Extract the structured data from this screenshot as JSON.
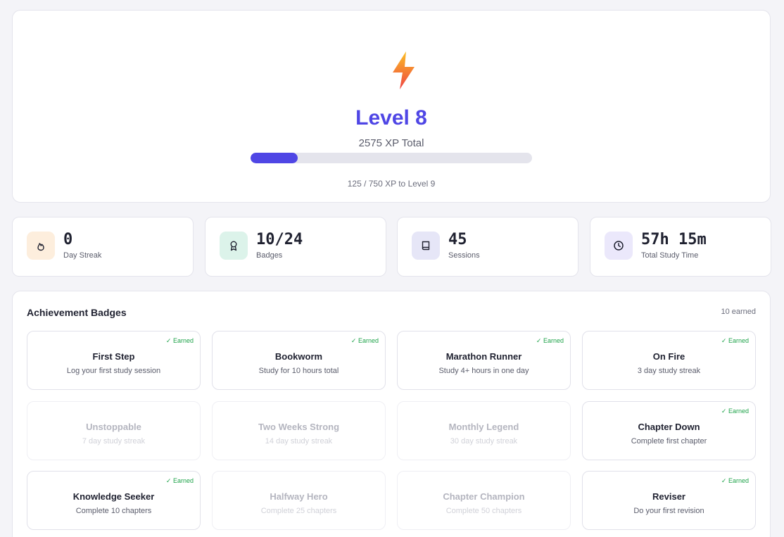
{
  "hero": {
    "level_label": "Level 8",
    "xp_total": "2575 XP Total",
    "progress_fraction": 0.1667,
    "progress_text": "125 / 750 XP to Level 9",
    "icon": "lightning-bolt-icon"
  },
  "stats": [
    {
      "value": "0",
      "label": "Day Streak",
      "icon": "flame-icon",
      "bg": "#fdeedd"
    },
    {
      "value": "10/24",
      "label": "Badges",
      "icon": "award-ribbon-icon",
      "bg": "#dcf3ea"
    },
    {
      "value": "45",
      "label": "Sessions",
      "icon": "book-icon",
      "bg": "#e6e6f7"
    },
    {
      "value": "57h 15m",
      "label": "Total Study Time",
      "icon": "clock-icon",
      "bg": "#ebe8fb"
    }
  ],
  "badges_panel": {
    "title": "Achievement Badges",
    "count": "10 earned",
    "earned_label": "✓ Earned",
    "items": [
      {
        "name": "First Step",
        "desc": "Log your first study session",
        "earned": true
      },
      {
        "name": "Bookworm",
        "desc": "Study for 10 hours total",
        "earned": true
      },
      {
        "name": "Marathon Runner",
        "desc": "Study 4+ hours in one day",
        "earned": true
      },
      {
        "name": "On Fire",
        "desc": "3 day study streak",
        "earned": true
      },
      {
        "name": "Unstoppable",
        "desc": "7 day study streak",
        "earned": false
      },
      {
        "name": "Two Weeks Strong",
        "desc": "14 day study streak",
        "earned": false
      },
      {
        "name": "Monthly Legend",
        "desc": "30 day study streak",
        "earned": false
      },
      {
        "name": "Chapter Down",
        "desc": "Complete first chapter",
        "earned": true
      },
      {
        "name": "Knowledge Seeker",
        "desc": "Complete 10 chapters",
        "earned": true
      },
      {
        "name": "Halfway Hero",
        "desc": "Complete 25 chapters",
        "earned": false
      },
      {
        "name": "Chapter Champion",
        "desc": "Complete 50 chapters",
        "earned": false
      },
      {
        "name": "Reviser",
        "desc": "Do your first revision",
        "earned": true
      }
    ]
  },
  "colors": {
    "accent": "#4f46e5",
    "earned": "#1fa34a",
    "bolt_top": "#fbbf24",
    "bolt_bottom": "#ef4444"
  }
}
